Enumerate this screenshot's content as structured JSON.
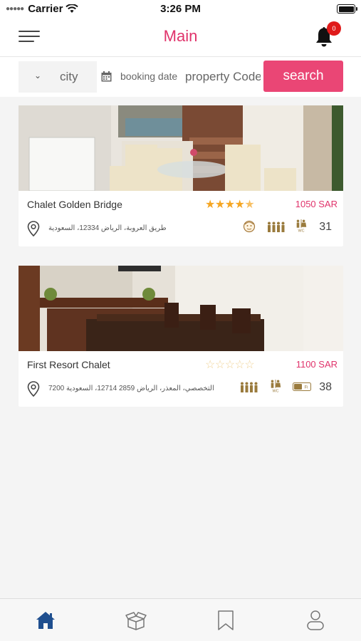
{
  "status_bar": {
    "carrier": "Carrier",
    "time": "3:26 PM"
  },
  "header": {
    "title": "Main",
    "notification_count": "0"
  },
  "filters": {
    "city": "city",
    "booking_date": "booking date",
    "property_code_placeholder": "property Code",
    "search_label": "search"
  },
  "listings": [
    {
      "name": "Chalet Golden Bridge",
      "rating": 4.5,
      "price": "1050 SAR",
      "address": "طريق العروبة، الرياض 12334، السعودية",
      "capacity": "31"
    },
    {
      "name": "First Resort Chalet",
      "rating": 0,
      "price": "1100 SAR",
      "address": "7200 التخصصي، المعذر، الرياض 2859 12714، السعودية",
      "capacity": "38"
    }
  ],
  "icons": {
    "menu": "hamburger-menu-icon",
    "bell": "bell-icon",
    "location": "location-pin-icon",
    "calendar": "calendar-icon",
    "home": "home-icon",
    "box": "box-icon",
    "bookmark": "bookmark-icon",
    "profile": "user-icon"
  },
  "colors": {
    "accent": "#e0336b",
    "button": "#ea4675",
    "star": "#f5a623",
    "tab_active": "#1f4f8f"
  }
}
